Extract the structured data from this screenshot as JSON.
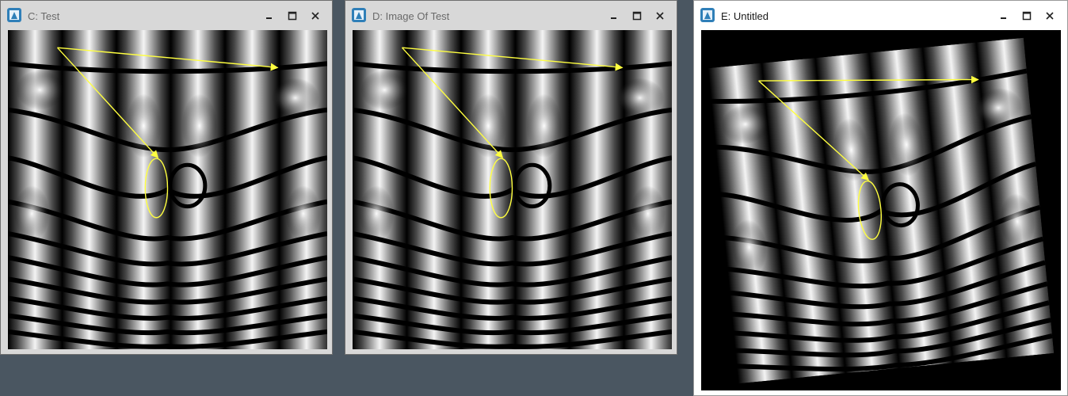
{
  "windows": [
    {
      "id": "C",
      "title": "C: Test",
      "state": "inactive"
    },
    {
      "id": "D",
      "title": "D: Image Of Test",
      "state": "inactive"
    },
    {
      "id": "E",
      "title": "E: Untitled",
      "state": "active"
    }
  ],
  "icons": {
    "app": "app-icon",
    "minimize": "minimize-icon",
    "maximize": "maximize-icon",
    "close": "close-icon"
  },
  "colors": {
    "desktop": "#4a5661",
    "overlay_annotation": "#ffff40",
    "inactive_frame": "#d8d8d8",
    "active_frame": "#ffffff"
  }
}
